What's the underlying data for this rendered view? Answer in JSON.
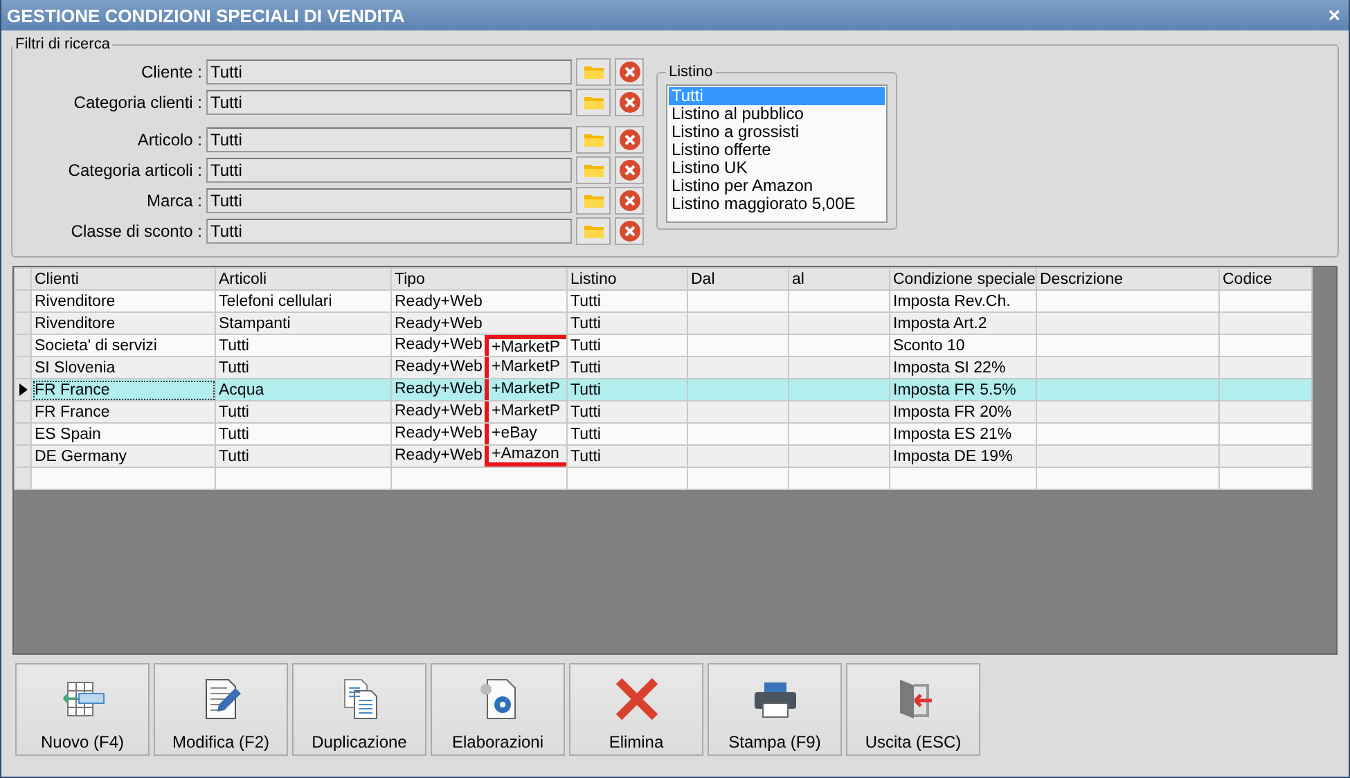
{
  "window": {
    "title": "GESTIONE CONDIZIONI SPECIALI DI VENDITA",
    "close": "×"
  },
  "filters": {
    "title": "Filtri di ricerca",
    "groups": [
      [
        {
          "label": "Cliente :",
          "value": "Tutti"
        },
        {
          "label": "Categoria clienti :",
          "value": "Tutti"
        }
      ],
      [
        {
          "label": "Articolo :",
          "value": "Tutti"
        },
        {
          "label": "Categoria articoli :",
          "value": "Tutti"
        },
        {
          "label": "Marca :",
          "value": "Tutti"
        },
        {
          "label": "Classe di sconto :",
          "value": "Tutti"
        }
      ]
    ]
  },
  "listino": {
    "title": "Listino",
    "items": [
      {
        "label": "Tutti",
        "selected": true
      },
      {
        "label": "Listino al pubblico",
        "selected": false
      },
      {
        "label": "Listino a grossisti",
        "selected": false
      },
      {
        "label": "Listino offerte",
        "selected": false
      },
      {
        "label": "Listino UK",
        "selected": false
      },
      {
        "label": "Listino per Amazon",
        "selected": false
      },
      {
        "label": "Listino maggiorato 5,00E",
        "selected": false
      }
    ]
  },
  "table": {
    "columns": [
      "Clienti",
      "Articoli",
      "Tipo",
      "Listino",
      "Dal",
      "al",
      "Condizione speciale",
      "Descrizione",
      "Codice"
    ],
    "rows": [
      {
        "selected": false,
        "cells": [
          "Rivenditore",
          "Telefoni cellulari",
          "Ready+Web",
          "Tutti",
          "",
          "",
          "Imposta Rev.Ch.",
          "",
          ""
        ]
      },
      {
        "selected": false,
        "cells": [
          "Rivenditore",
          "Stampanti",
          "Ready+Web",
          "Tutti",
          "",
          "",
          "Imposta Art.2",
          "",
          ""
        ]
      },
      {
        "selected": false,
        "cells": [
          "Societa' di servizi",
          "Tutti",
          "Ready+Web",
          "Tutti",
          "",
          "",
          "Sconto 10",
          "",
          ""
        ],
        "tipo_suffix": "+MarketP",
        "highlighted": true
      },
      {
        "selected": false,
        "cells": [
          "SI Slovenia",
          "Tutti",
          "Ready+Web",
          "Tutti",
          "",
          "",
          "Imposta SI 22%",
          "",
          ""
        ],
        "tipo_suffix": "+MarketP",
        "highlighted": true
      },
      {
        "selected": true,
        "cells": [
          "FR France",
          "Acqua",
          "Ready+Web",
          "Tutti",
          "",
          "",
          "Imposta FR 5.5%",
          "",
          ""
        ],
        "tipo_suffix": "+MarketP",
        "highlighted": true
      },
      {
        "selected": false,
        "cells": [
          "FR France",
          "Tutti",
          "Ready+Web",
          "Tutti",
          "",
          "",
          "Imposta FR 20%",
          "",
          ""
        ],
        "tipo_suffix": "+MarketP",
        "highlighted": true
      },
      {
        "selected": false,
        "cells": [
          "ES Spain",
          "Tutti",
          "Ready+Web",
          "Tutti",
          "",
          "",
          "Imposta ES 21%",
          "",
          ""
        ],
        "tipo_suffix": "+eBay",
        "highlighted": true
      },
      {
        "selected": false,
        "cells": [
          "DE Germany",
          "Tutti",
          "Ready+Web",
          "Tutti",
          "",
          "",
          "Imposta DE 19%",
          "",
          ""
        ],
        "tipo_suffix": "+Amazon",
        "highlighted": true
      }
    ]
  },
  "buttons": [
    {
      "label": "Nuovo (F4)",
      "kind": "new"
    },
    {
      "label": "Modifica (F2)",
      "kind": "edit"
    },
    {
      "label": "Duplicazione",
      "kind": "copy"
    },
    {
      "label": "Elaborazioni",
      "kind": "process"
    },
    {
      "label": "Elimina",
      "kind": "delete"
    },
    {
      "label": "Stampa (F9)",
      "kind": "print"
    },
    {
      "label": "Uscita (ESC)",
      "kind": "exit"
    }
  ]
}
